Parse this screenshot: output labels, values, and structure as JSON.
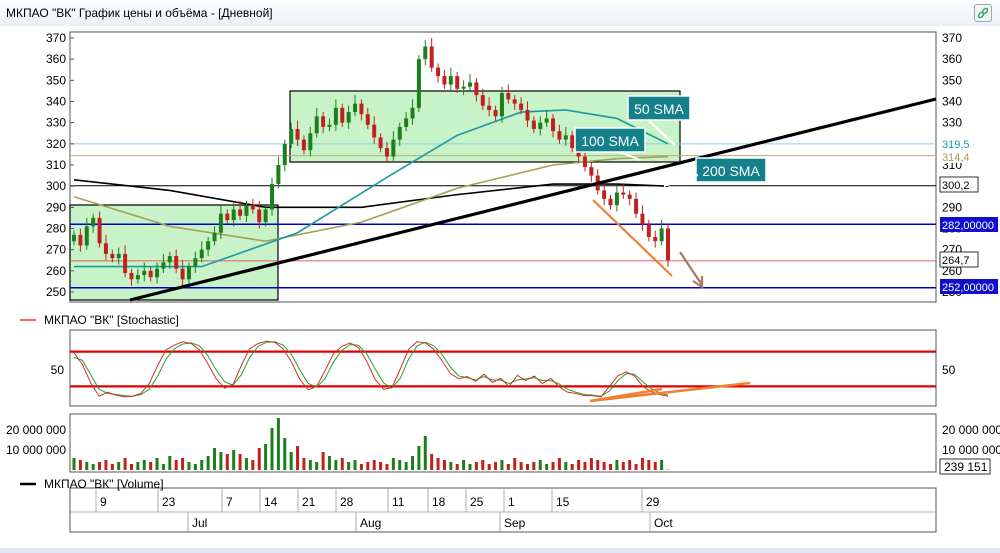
{
  "window": {
    "title": "МКПАО \"ВК\" График цены и объёма - [Дневной]"
  },
  "price_panel": {
    "right_labels": [
      "319,5",
      "314,4",
      "300,2",
      "282,00000",
      "264,7",
      "252,00000"
    ],
    "annotations": [
      "50 SMA",
      "100 SMA",
      "200 SMA"
    ]
  },
  "stoch_panel": {
    "legend": "МКПАО \"ВК\" [Stochastic]",
    "tick": "50"
  },
  "volume_panel": {
    "legend": "МКПАО \"ВК\" [Volume]",
    "last_volume": "239 151"
  },
  "colors": {
    "sma50": "#1a9aa0",
    "sma100": "#a4a055",
    "sma200": "#000000",
    "up": "#1b7f1b",
    "down": "#c22020",
    "hline_blue": "#0000cc",
    "hline_red": "#e00000",
    "arrow": "#f08030",
    "box_fill": "#b8efb8"
  },
  "chart_data": [
    {
      "type": "candlestick",
      "title": "",
      "y_ticks": [
        250,
        260,
        270,
        280,
        290,
        300,
        310,
        320,
        330,
        340,
        350,
        360,
        370
      ],
      "right_ticks": [
        250,
        260,
        270,
        280,
        290,
        300,
        310,
        320,
        330,
        340,
        350,
        360,
        370
      ],
      "ylim": [
        243,
        372
      ],
      "x_ticks": [
        "9",
        "23",
        "7",
        "14",
        "21",
        "28",
        "11",
        "18",
        "25",
        "1",
        "15",
        "29"
      ],
      "months": [
        "Jul",
        "Aug",
        "Sep",
        "Oct"
      ],
      "closes": [
        277,
        272,
        281,
        285,
        273,
        268,
        266,
        268,
        259,
        256,
        258,
        260,
        257,
        261,
        264,
        267,
        261,
        256,
        262,
        266,
        270,
        274,
        278,
        287,
        284,
        289,
        286,
        291,
        289,
        283,
        289,
        301,
        310,
        320,
        327,
        322,
        317,
        325,
        333,
        328,
        329,
        337,
        330,
        335,
        339,
        334,
        329,
        323,
        318,
        314,
        322,
        328,
        332,
        337,
        360,
        366,
        356,
        352,
        348,
        352,
        346,
        347,
        349,
        343,
        338,
        336,
        333,
        344,
        341,
        339,
        336,
        331,
        327,
        330,
        332,
        326,
        322,
        324,
        318,
        314,
        309,
        305,
        298,
        294,
        291,
        297,
        296,
        294,
        287,
        282,
        276,
        274,
        280,
        265
      ],
      "sma50": [
        [
          0,
          262
        ],
        [
          20,
          262
        ],
        [
          35,
          278
        ],
        [
          50,
          306
        ],
        [
          60,
          324
        ],
        [
          70,
          335
        ],
        [
          77,
          336
        ],
        [
          85,
          332
        ],
        [
          93,
          320
        ]
      ],
      "sma100": [
        [
          0,
          295
        ],
        [
          15,
          281
        ],
        [
          30,
          274
        ],
        [
          45,
          283
        ],
        [
          60,
          299
        ],
        [
          75,
          310
        ],
        [
          85,
          313
        ],
        [
          93,
          314
        ]
      ],
      "sma200": [
        [
          0,
          303
        ],
        [
          15,
          298
        ],
        [
          30,
          290
        ],
        [
          45,
          290
        ],
        [
          60,
          296
        ],
        [
          75,
          301
        ],
        [
          85,
          301
        ],
        [
          93,
          300
        ]
      ],
      "hlines": [
        320,
        314.4,
        300.2,
        282,
        264.7,
        252
      ]
    },
    {
      "type": "line",
      "title": "",
      "ylim": [
        0,
        100
      ],
      "levels": [
        80,
        20
      ],
      "k": [
        78,
        58,
        26,
        3,
        10,
        5,
        2,
        3,
        8,
        25,
        56,
        83,
        91,
        97,
        94,
        83,
        59,
        33,
        17,
        23,
        56,
        85,
        94,
        98,
        96,
        85,
        62,
        32,
        14,
        20,
        47,
        76,
        89,
        95,
        87,
        63,
        32,
        15,
        18,
        50,
        84,
        97,
        95,
        84,
        64,
        42,
        33,
        37,
        29,
        41,
        27,
        34,
        20,
        39,
        30,
        38,
        25,
        34,
        19,
        10,
        8,
        4,
        4,
        2,
        20,
        38,
        45,
        38,
        20,
        11,
        6,
        3
      ],
      "d": [
        70,
        65,
        40,
        15,
        8,
        6,
        4,
        3,
        6,
        15,
        38,
        67,
        85,
        93,
        95,
        90,
        73,
        48,
        28,
        22,
        40,
        70,
        89,
        96,
        97,
        91,
        75,
        48,
        25,
        19,
        33,
        62,
        82,
        92,
        91,
        76,
        50,
        26,
        17,
        34,
        67,
        90,
        96,
        90,
        75,
        53,
        38,
        35,
        31,
        37,
        31,
        31,
        25,
        31,
        33,
        35,
        30,
        30,
        24,
        15,
        10,
        6,
        5,
        3,
        12,
        30,
        42,
        41,
        28,
        16,
        9,
        5
      ]
    },
    {
      "type": "bar",
      "title": "",
      "y_ticks": [
        "10 000 000",
        "20 000 000"
      ],
      "ylim": [
        0,
        25000000
      ],
      "values": [
        6,
        5,
        4,
        3,
        4,
        5,
        3,
        4,
        6,
        3,
        4,
        5,
        4,
        6,
        3,
        7,
        5,
        6,
        4,
        3,
        5,
        7,
        11,
        9,
        8,
        10,
        8,
        6,
        5,
        11,
        13,
        21,
        26,
        16,
        9,
        12,
        6,
        5,
        4,
        9,
        7,
        5,
        6,
        4,
        5,
        3,
        4,
        5,
        4,
        3,
        6,
        5,
        4,
        7,
        12,
        17,
        8,
        6,
        5,
        4,
        3,
        5,
        3,
        4,
        5,
        3,
        4,
        5,
        3,
        6,
        4,
        3,
        4,
        5,
        3,
        4,
        6,
        4,
        3,
        5,
        4,
        6,
        5,
        4,
        3,
        5,
        4,
        5,
        3,
        6,
        5,
        4,
        5,
        0.2
      ],
      "value_unit": "millions"
    }
  ]
}
